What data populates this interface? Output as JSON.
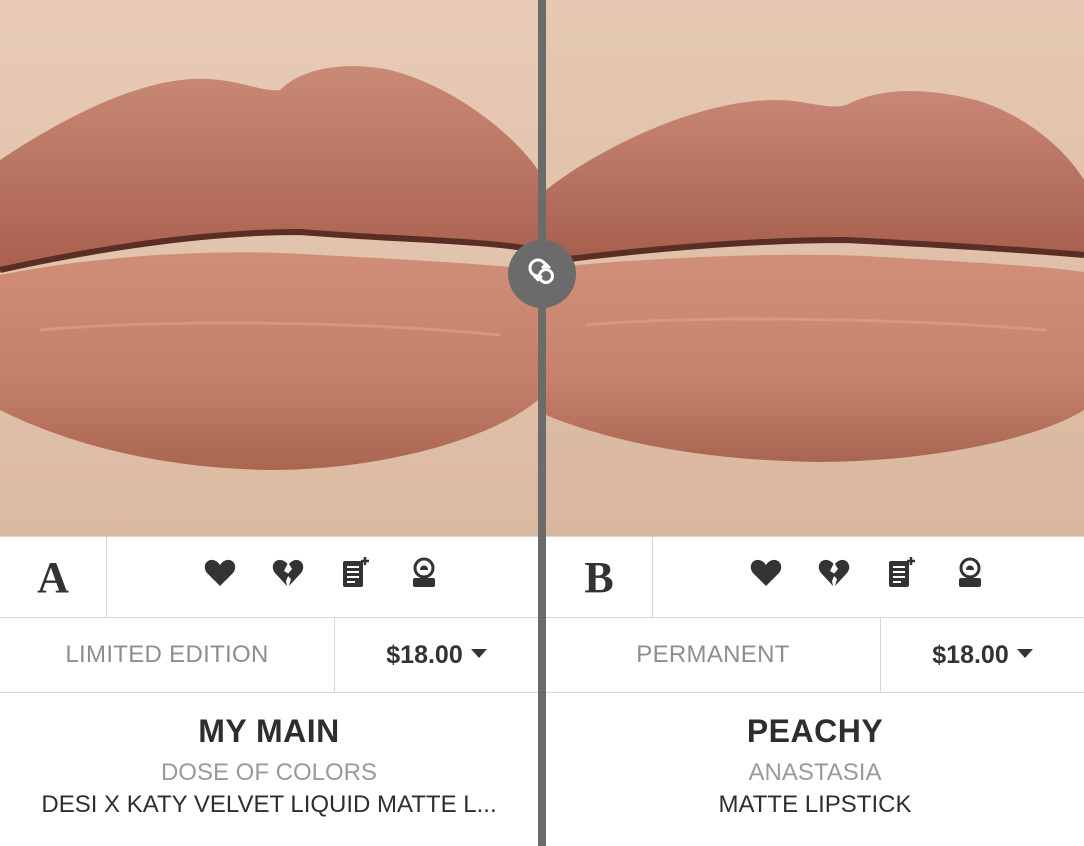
{
  "swatch_a": {
    "letter": "A",
    "status": "LIMITED EDITION",
    "price": "$18.00",
    "name": "MY MAIN",
    "brand": "DOSE OF COLORS",
    "product": "DESI X KATY VELVET LIQUID MATTE L...",
    "lip_color": "#c07a66",
    "skin_color": "#e3c3ad"
  },
  "swatch_b": {
    "letter": "B",
    "status": "PERMANENT",
    "price": "$18.00",
    "name": "PEACHY",
    "brand": "ANASTASIA",
    "product": "MATTE LIPSTICK",
    "lip_color": "#c27a67",
    "skin_color": "#e0c2aa"
  },
  "action_icons": [
    "heart-icon",
    "broken-heart-icon",
    "add-to-list-icon",
    "dupe-finder-icon"
  ],
  "swap_icon": "swap-icon",
  "colors": {
    "divider": "#6b6b6b",
    "text": "#333333",
    "muted": "#8e8e8e",
    "border": "#d6d6d6"
  }
}
